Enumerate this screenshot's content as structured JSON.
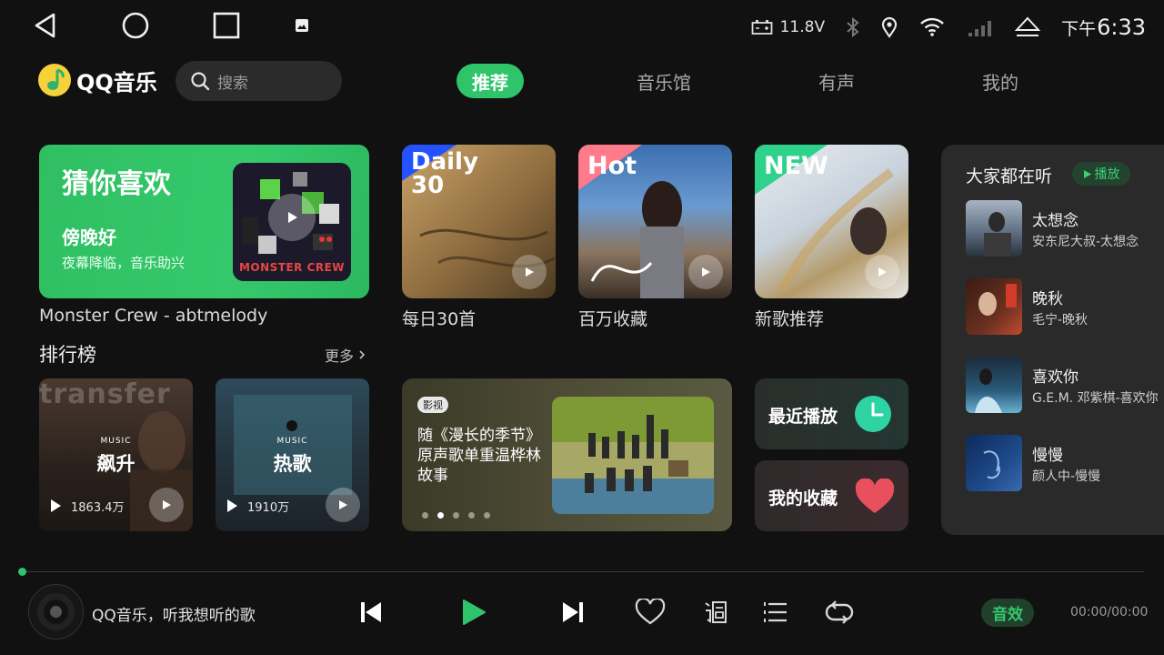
{
  "status_bar": {
    "battery_voltage": "11.8V",
    "time_prefix": "下午",
    "time": "6:33"
  },
  "header": {
    "logo_text": "QQ音乐",
    "search_placeholder": "搜索",
    "tabs": [
      "推荐",
      "音乐馆",
      "有声",
      "我的"
    ],
    "active_tab": "推荐"
  },
  "guess": {
    "title": "猜你喜欢",
    "song": "傍晚好",
    "subtitle": "夜幕降临，音乐助兴",
    "art_text": "MONSTER CREW",
    "caption": "Monster Crew - abtmelody"
  },
  "tiles": [
    {
      "badge_line1": "Daily",
      "badge_line2": "30",
      "caption": "每日30首"
    },
    {
      "badge_line1": "Hot",
      "badge_line2": "",
      "caption": "百万收藏"
    },
    {
      "badge_line1": "NEW",
      "badge_line2": "",
      "caption": "新歌推荐"
    }
  ],
  "rankings": {
    "title": "排行榜",
    "more": "更多",
    "items": [
      {
        "name": "飙升",
        "count": "1863.4万",
        "bg_text": "transfer"
      },
      {
        "name": "热歌",
        "count": "1910万",
        "bg_text": ""
      }
    ]
  },
  "banner": {
    "tag": "影视",
    "text": "随《漫长的季节》原声歌单重温桦林故事",
    "dots": 5,
    "active_dot": 1
  },
  "quick": {
    "recent": "最近播放",
    "favorites": "我的收藏"
  },
  "panel": {
    "title": "大家都在听",
    "play_label": "播放",
    "songs": [
      {
        "title": "太想念",
        "artist": "安东尼大叔-太想念"
      },
      {
        "title": "晚秋",
        "artist": "毛宁-晚秋"
      },
      {
        "title": "喜欢你",
        "artist": "G.E.M. 邓紫棋-喜欢你"
      },
      {
        "title": "慢慢",
        "artist": "颜人中-慢慢"
      }
    ]
  },
  "player": {
    "now_playing": "QQ音乐，听我想听的歌",
    "effect_label": "音效",
    "time": "00:00/00:00",
    "progress": 0
  },
  "colors": {
    "accent": "#2fc46a",
    "background": "#111111",
    "panel": "#2a2a2a"
  }
}
